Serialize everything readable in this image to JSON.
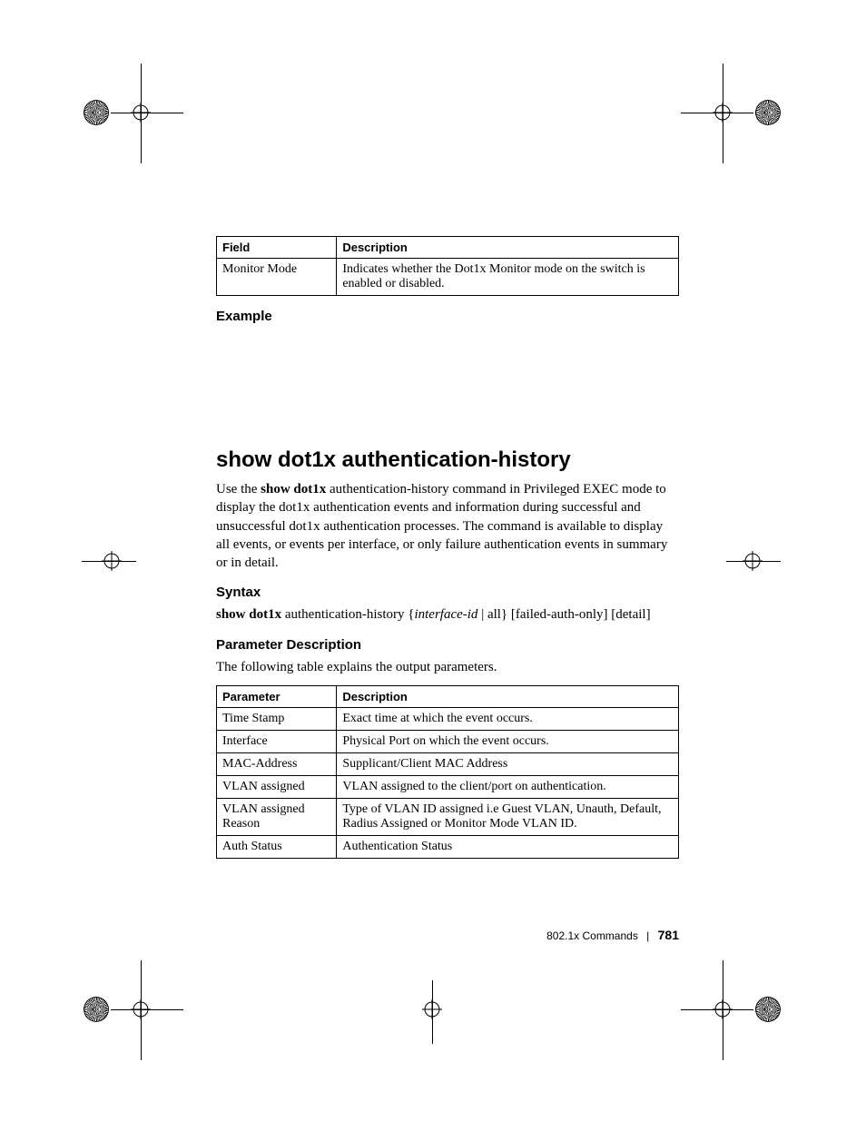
{
  "table1": {
    "headers": [
      "Field",
      "Description"
    ],
    "rows": [
      [
        "Monitor Mode",
        "Indicates whether the Dot1x Monitor mode on the switch is enabled or disabled."
      ]
    ]
  },
  "headings": {
    "example": "Example",
    "h2": "show dot1x authentication-history",
    "syntax": "Syntax",
    "param_desc": "Parameter Description"
  },
  "body": {
    "intro_pre": "Use the ",
    "intro_bold": "show dot1x",
    "intro_post": " authentication-history command in Privileged EXEC mode to display the dot1x authentication events and information during successful and unsuccessful dot1x authentication processes. The command is available to display all events, or events per interface, or only failure authentication events in summary or in detail.",
    "syntax_bold": "show dot1x",
    "syntax_plain1": " authentication-history {",
    "syntax_ital": "interface-id",
    "syntax_plain2": "  | all} [failed-auth-only] [detail]",
    "param_intro": "The following table explains the output parameters."
  },
  "table2": {
    "headers": [
      "Parameter",
      "Description"
    ],
    "rows": [
      [
        "Time Stamp",
        "Exact time at which the event occurs."
      ],
      [
        "Interface",
        "Physical Port on which the event occurs."
      ],
      [
        "MAC-Address",
        "Supplicant/Client MAC Address"
      ],
      [
        "VLAN assigned",
        "VLAN assigned to the client/port on authentication."
      ],
      [
        "VLAN assigned Reason",
        "Type of VLAN ID assigned i.e Guest VLAN, Unauth, Default, Radius Assigned or Monitor Mode VLAN ID."
      ],
      [
        "Auth Status",
        "Authentication Status"
      ]
    ]
  },
  "footer": {
    "section": "802.1x Commands",
    "page": "781"
  }
}
